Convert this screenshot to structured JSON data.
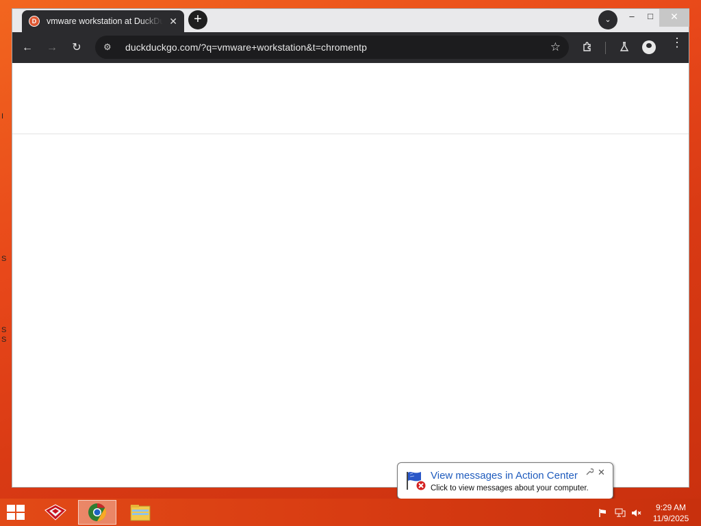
{
  "desktop": {
    "edge_texts": [
      "I",
      "S",
      "S",
      "S"
    ]
  },
  "browser": {
    "tab": {
      "title": "vmware workstation at DuckDuckGo",
      "favicon": "duckduckgo-icon",
      "close_icon": "✕"
    },
    "new_tab_icon": "+",
    "tab_search_icon": "⌄",
    "window_controls": {
      "minimize": "–",
      "maximize": "□",
      "close": "✕"
    },
    "toolbar": {
      "back_icon": "←",
      "forward_icon": "→",
      "reload_icon": "↻",
      "site_info_icon": "⚙",
      "url": "duckduckgo.com/?q=vmware+workstation&t=chromentp",
      "bookmark_icon": "☆",
      "extensions_icon": "puzzle-icon",
      "labs_icon": "flask-icon",
      "profile_icon": "profile-icon",
      "menu_icon": "⋮"
    }
  },
  "notification": {
    "title": "View messages in Action Center",
    "text": "Click to view messages about your computer.",
    "icon": "action-center-flag-icon",
    "close_icon": "✕",
    "settings_icon": "🔧"
  },
  "taskbar": {
    "apps": [
      "start-menu",
      "app-red-icon",
      "chrome-icon",
      "file-explorer-icon"
    ],
    "tray": [
      "action-center-icon",
      "network-icon",
      "volume-muted-icon"
    ],
    "clock": {
      "time": "9:29 AM",
      "date": "11/9/2025"
    }
  },
  "colors": {
    "desktop_bg": "#e8481a",
    "browser_dark": "#2b2b2e",
    "balloon_title": "#1e5bbd"
  }
}
